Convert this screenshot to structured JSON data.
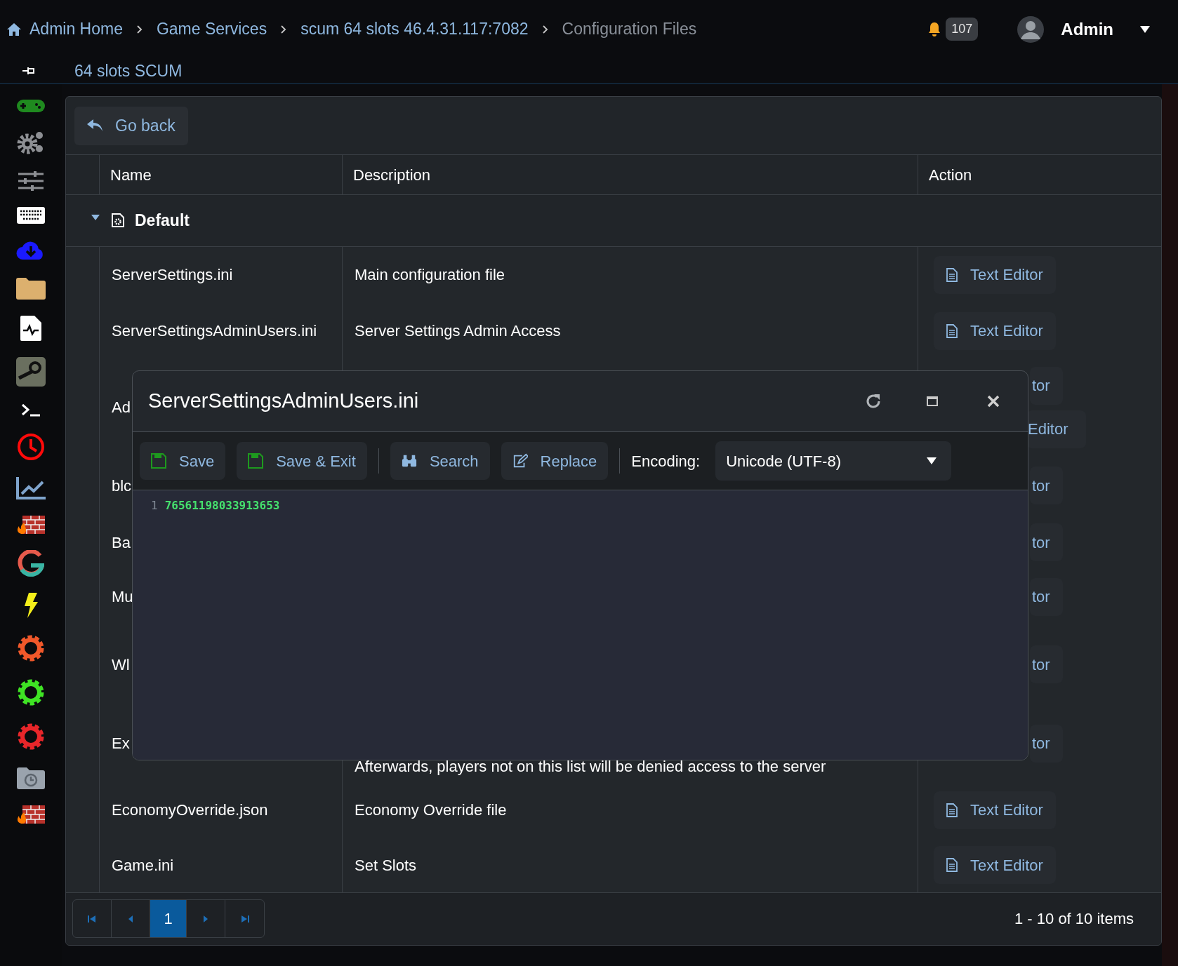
{
  "breadcrumb": [
    {
      "label": "Admin Home",
      "current": false
    },
    {
      "label": "Game Services",
      "current": false
    },
    {
      "label": "scum 64 slots 46.4.31.117:7082",
      "current": false
    },
    {
      "label": "Configuration Files",
      "current": true
    }
  ],
  "notifications": {
    "count": "107"
  },
  "user": {
    "name": "Admin"
  },
  "subtitle": "64 slots SCUM",
  "sidebar": {
    "items": [
      {
        "kind": "gamepad"
      },
      {
        "kind": "gears"
      },
      {
        "kind": "sliders"
      },
      {
        "kind": "keyboard"
      },
      {
        "kind": "cloud"
      },
      {
        "kind": "folder"
      },
      {
        "kind": "file"
      },
      {
        "kind": "tile"
      },
      {
        "kind": "terminal"
      },
      {
        "kind": "clock"
      },
      {
        "kind": "chart"
      },
      {
        "kind": "wall"
      },
      {
        "kind": "g"
      },
      {
        "kind": "bolt"
      },
      {
        "kind": "gear",
        "color": "#f0582a"
      },
      {
        "kind": "gear",
        "color": "#3fe324"
      },
      {
        "kind": "gear",
        "color": "#e8262a"
      },
      {
        "kind": "archive"
      },
      {
        "kind": "wall"
      }
    ]
  },
  "go_back": "Go back",
  "table": {
    "columns": [
      "Name",
      "Description",
      "Action"
    ],
    "group": {
      "label": "Default",
      "expanded": true
    },
    "rows": [
      {
        "name": "ServerSettings.ini",
        "description": "Main configuration file",
        "actions": [
          "Text Editor"
        ]
      },
      {
        "name": "ServerSettingsAdminUsers.ini",
        "description": "Server Settings Admin Access",
        "actions": [
          "Text Editor"
        ]
      },
      {
        "name": "Ad",
        "actions": [
          "tor",
          "Editor"
        ]
      },
      {
        "name": "blc",
        "actions": [
          "tor"
        ]
      },
      {
        "name": "Ba",
        "actions": [
          "tor"
        ]
      },
      {
        "name": "Mu",
        "actions": [
          "tor"
        ]
      },
      {
        "name": "Wl",
        "actions": [
          "tor"
        ]
      },
      {
        "name": "Ex",
        "description": "Afterwards, players not on this list will be denied access to the server",
        "actions": [
          "tor"
        ]
      },
      {
        "name": "EconomyOverride.json",
        "description": "Economy Override file",
        "actions": [
          "Text Editor"
        ]
      },
      {
        "name": "Game.ini",
        "description": "Set Slots",
        "actions": [
          "Text Editor"
        ]
      }
    ]
  },
  "pagination": {
    "pages": [
      {
        "label": "1",
        "selected": true
      }
    ],
    "summary": "1 - 10 of 10 items"
  },
  "modal": {
    "title": "ServerSettingsAdminUsers.ini",
    "toolbar": [
      {
        "label": "Save",
        "kind": "save"
      },
      {
        "label": "Save & Exit",
        "kind": "save"
      },
      {
        "label": "Search",
        "kind": "search"
      },
      {
        "label": "Replace",
        "kind": "replace"
      }
    ],
    "encoding": {
      "label": "Encoding:",
      "value": "Unicode (UTF-8)"
    },
    "editor": {
      "lines": [
        {
          "number": "1",
          "text": "76561198033913653"
        }
      ]
    }
  }
}
